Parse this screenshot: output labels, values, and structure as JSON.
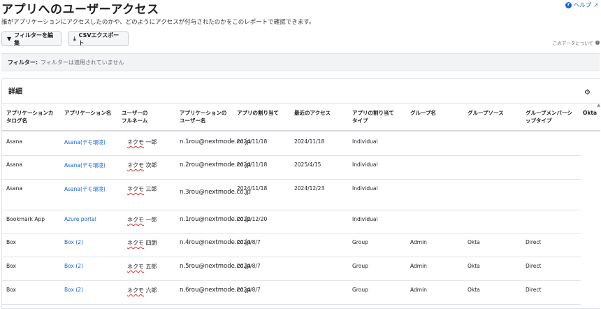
{
  "page": {
    "title": "アプリへのユーザーアクセス",
    "description": "誰がアプリケーションにアクセスしたのかや、どのようにアクセスが付与されたのかをこのレポートで確認できます。",
    "help_label": "ヘルプ",
    "about_label": "このデータについて"
  },
  "toolbar": {
    "edit_filters": "フィルターを編集",
    "export_csv": "CSVエクスポート"
  },
  "filter": {
    "label": "フィルター:",
    "value": "フィルターは適用されていません"
  },
  "details": {
    "title": "詳細",
    "columns": [
      "アプリケーションカ\nタログ名",
      "アプリケーション名",
      "ユーザーの\nフルネーム",
      "アプリケーションの\nユーザー名",
      "アプリの割り当て",
      "最近のアクセス",
      "アプリの割り当て\nタイプ",
      "グループ名",
      "グループソース",
      "グループメンバーシ\nップタイプ",
      "Okta"
    ],
    "rows": [
      {
        "catalog": "Asana",
        "app": "Asana(デモ環境)",
        "name_last": "ネクモ",
        "name_first": "一郎",
        "user": "n.1rou@nextmode.co.jp",
        "assigned": "2024/11/18",
        "last": "2024/11/18",
        "type": "Individual",
        "group": "",
        "source": "",
        "membership": ""
      },
      {
        "catalog": "Asana",
        "app": "Asana(デモ環境)",
        "name_last": "ネクモ",
        "name_first": "次郎",
        "user": "n.2rou@nextmode.co.jp",
        "assigned": "2024/11/18",
        "last": "2025/4/15",
        "type": "Individual",
        "group": "",
        "source": "",
        "membership": ""
      },
      {
        "catalog": "Asana",
        "app": "Asana(デモ環境)",
        "name_last": "ネクモ",
        "name_first": "三郎",
        "user": "n.3rou@nextmode.co.jp",
        "assigned": "2024/11/18",
        "last": "2024/12/23",
        "type": "Individual",
        "group": "",
        "source": "",
        "membership": ""
      },
      {
        "catalog": "Bookmark App",
        "app": "Azure portal",
        "name_last": "ネクモ",
        "name_first": "一郎",
        "user": "n.1rou@nextmode.co.jp",
        "assigned": "2022/12/20",
        "last": "",
        "type": "Individual",
        "group": "",
        "source": "",
        "membership": ""
      },
      {
        "catalog": "Box",
        "app": "Box (2)",
        "name_last": "ネクモ",
        "name_first": "四朗",
        "user": "n.4rou@nextmode.co.jp",
        "assigned": "2024/8/7",
        "last": "",
        "type": "Group",
        "group": "Admin",
        "source": "Okta",
        "membership": "Direct"
      },
      {
        "catalog": "Box",
        "app": "Box (2)",
        "name_last": "ネクモ",
        "name_first": "五郎",
        "user": "n.5rou@nextmode.co.jp",
        "assigned": "2024/8/7",
        "last": "",
        "type": "Group",
        "group": "Admin",
        "source": "Okta",
        "membership": "Direct"
      },
      {
        "catalog": "Box",
        "app": "Box (2)",
        "name_last": "ネクモ",
        "name_first": "六郎",
        "user": "n.6rou@nextmode.co.jp",
        "assigned": "2024/8/7",
        "last": "",
        "type": "Group",
        "group": "Admin",
        "source": "Okta",
        "membership": "Direct"
      }
    ]
  }
}
